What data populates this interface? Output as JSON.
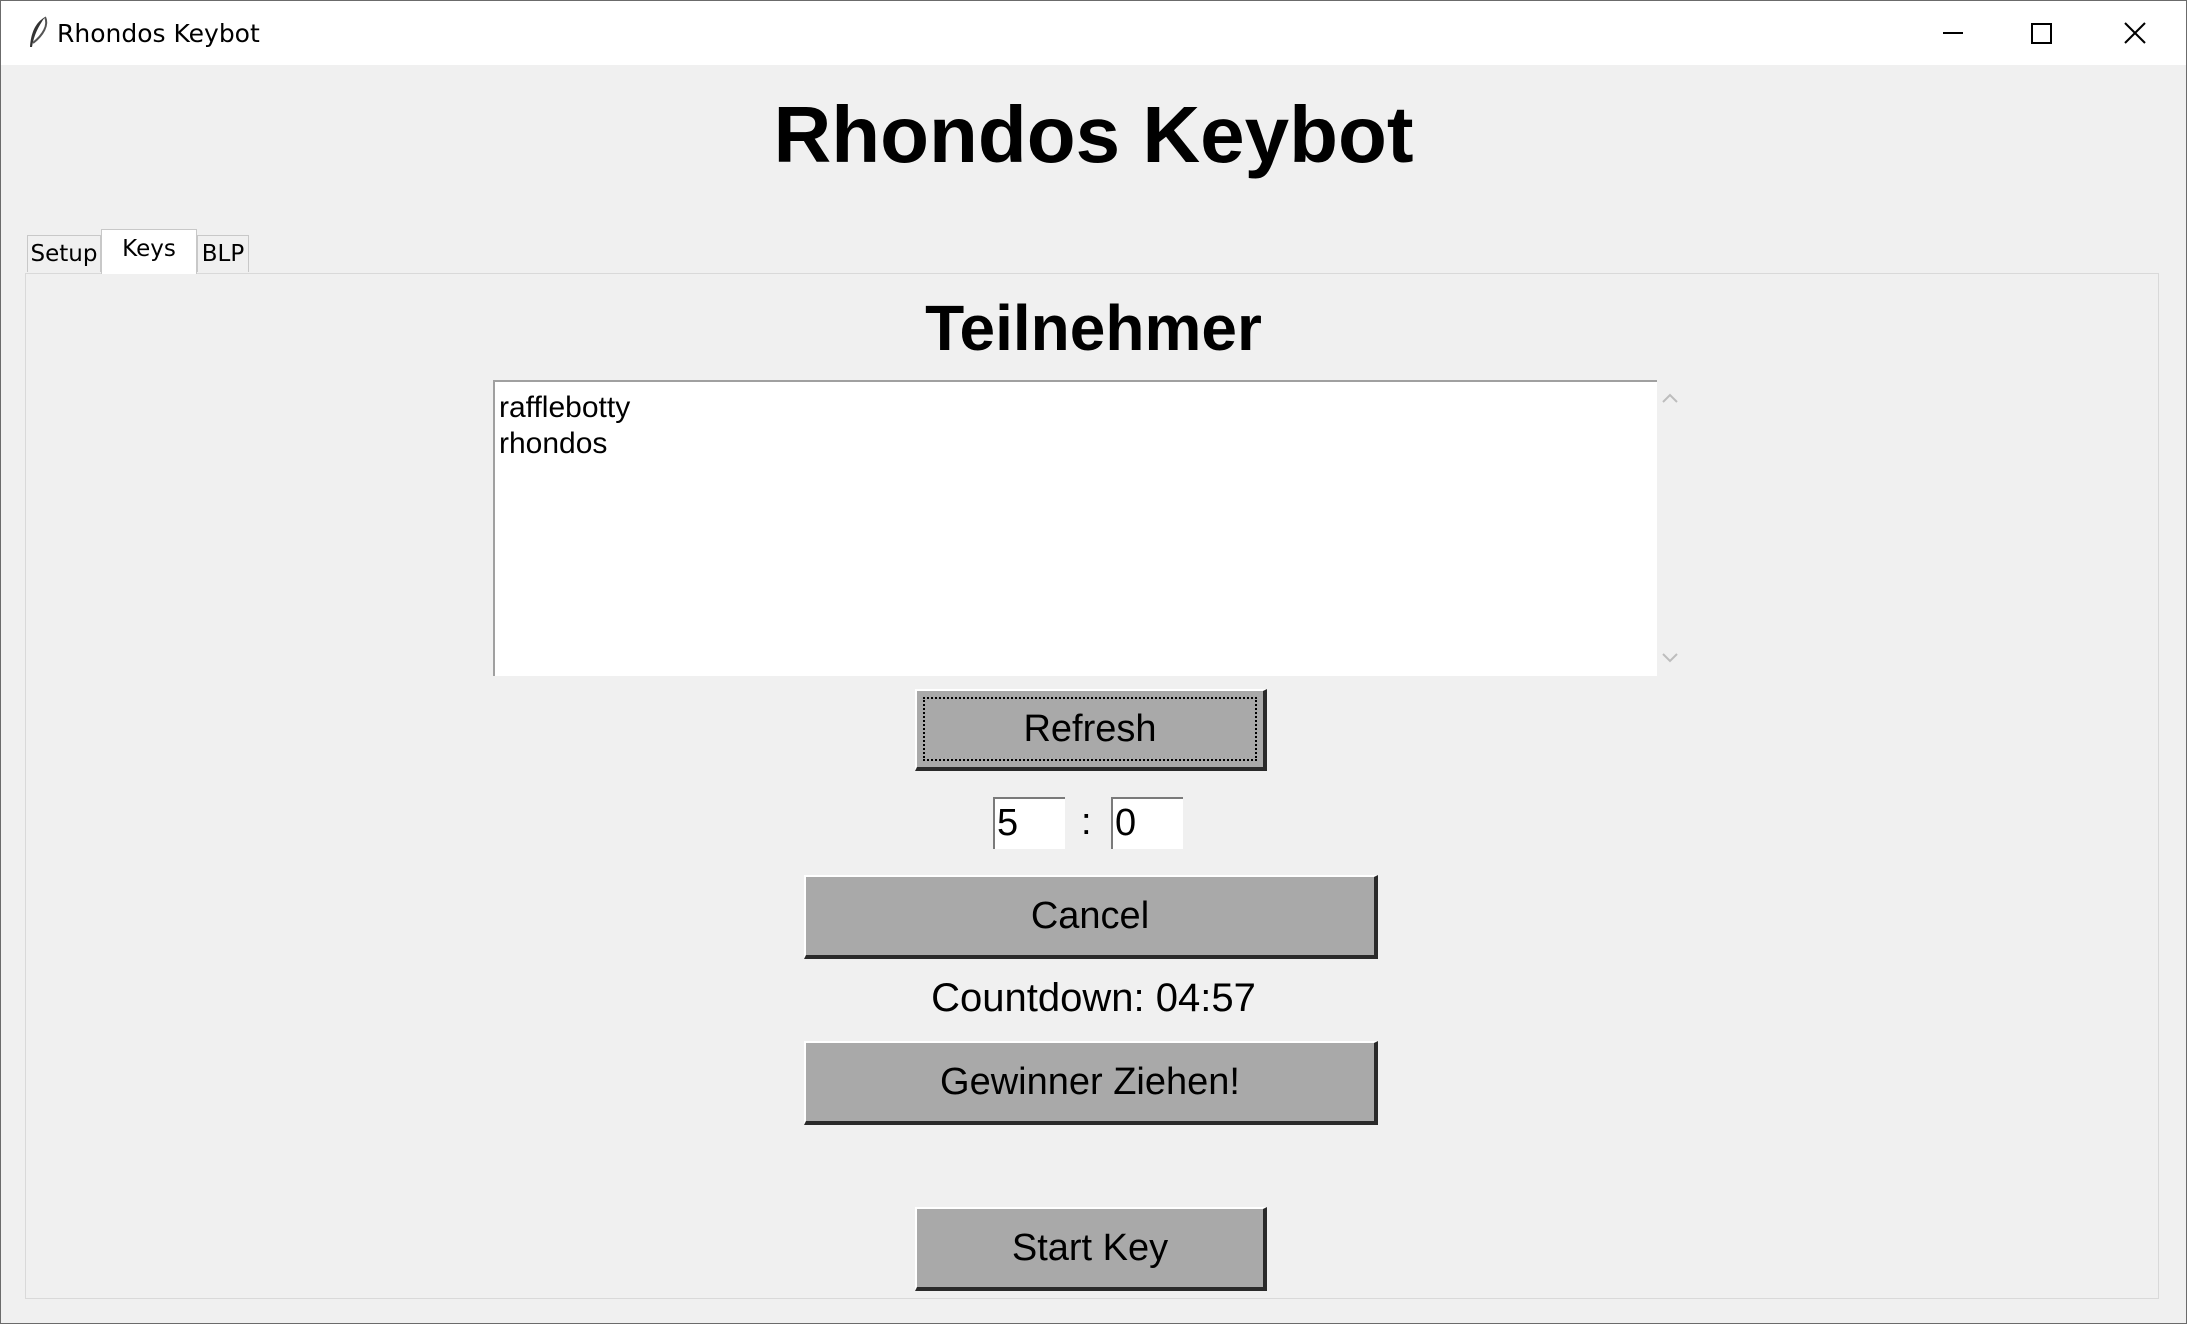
{
  "window": {
    "title": "Rhondos Keybot",
    "app_icon": "feather-icon",
    "controls": [
      "minimize-icon",
      "maximize-icon",
      "close-icon"
    ]
  },
  "header": {
    "title": "Rhondos Keybot"
  },
  "tabs": [
    {
      "label": "Setup",
      "active": false
    },
    {
      "label": "Keys",
      "active": true
    },
    {
      "label": "BLP",
      "active": false
    }
  ],
  "keys_tab": {
    "section_title": "Teilnehmer",
    "participants": [
      "rafflebotty",
      "rhondos"
    ],
    "refresh_label": "Refresh",
    "timer": {
      "minutes": "5",
      "separator": ":",
      "seconds": "0"
    },
    "cancel_label": "Cancel",
    "countdown_label": "Countdown:",
    "countdown_value": "04:57",
    "draw_winner_label": "Gewinner Ziehen!",
    "start_key_label": "Start Key"
  }
}
